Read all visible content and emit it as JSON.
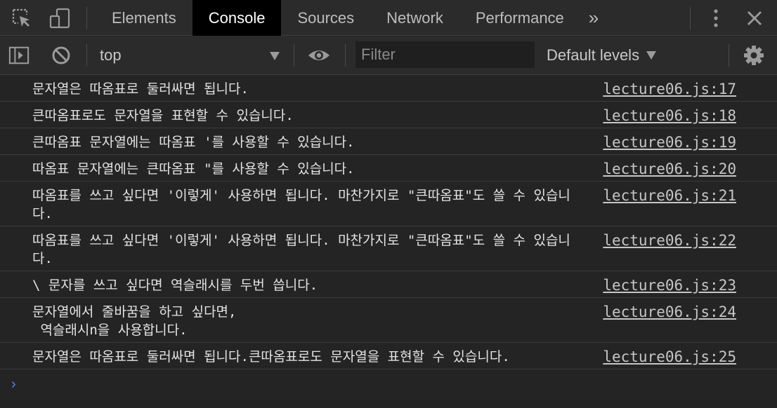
{
  "tabbar": {
    "tabs": [
      {
        "label": "Elements"
      },
      {
        "label": "Console"
      },
      {
        "label": "Sources"
      },
      {
        "label": "Network"
      },
      {
        "label": "Performance"
      }
    ],
    "more_label": "»",
    "icons": [
      "inspect-element-icon",
      "device-toggle-icon",
      "more-vert-icon",
      "close-icon"
    ]
  },
  "toolbar": {
    "context": "top",
    "filter_placeholder": "Filter",
    "levels_label": "Default levels",
    "icons": [
      "sidebar-toggle-icon",
      "clear-console-icon",
      "dropdown-arrow-icon",
      "eye-icon",
      "gear-icon"
    ]
  },
  "console": {
    "messages": [
      {
        "text": "문자열은 따옴표로 둘러싸면 됩니다.",
        "source": "lecture06.js:17"
      },
      {
        "text": "큰따옴표로도 문자열을 표현할 수 있습니다.",
        "source": "lecture06.js:18"
      },
      {
        "text": "큰따옴표 문자열에는 따옴표 '를 사용할 수 있습니다.",
        "source": "lecture06.js:19"
      },
      {
        "text": "따옴표 문자열에는 큰따옴표 \"를 사용할 수 있습니다.",
        "source": "lecture06.js:20"
      },
      {
        "text": "따옴표를 쓰고 싶다면 '이렇게' 사용하면 됩니다. 마찬가지로 \"큰따옴표\"도 쓸 수 있습니다.",
        "source": "lecture06.js:21"
      },
      {
        "text": "따옴표를 쓰고 싶다면 '이렇게' 사용하면 됩니다. 마찬가지로 \"큰따옴표\"도 쓸 수 있습니다.",
        "source": "lecture06.js:22"
      },
      {
        "text": "\\ 문자를 쓰고 싶다면 역슬래시를 두번 씁니다.",
        "source": "lecture06.js:23"
      },
      {
        "text": "문자열에서 줄바꿈을 하고 싶다면,\n 역슬래시n을 사용합니다.",
        "source": "lecture06.js:24"
      },
      {
        "text": "문자열은 따옴표로 둘러싸면 됩니다.큰따옴표로도 문자열을 표현할 수 있습니다.",
        "source": "lecture06.js:25"
      }
    ],
    "prompt_glyph": "›"
  },
  "colors": {
    "background": "#242424",
    "toolbar": "#2b2b2b",
    "active_tab": "#000000",
    "prompt": "#4e8cf5"
  }
}
